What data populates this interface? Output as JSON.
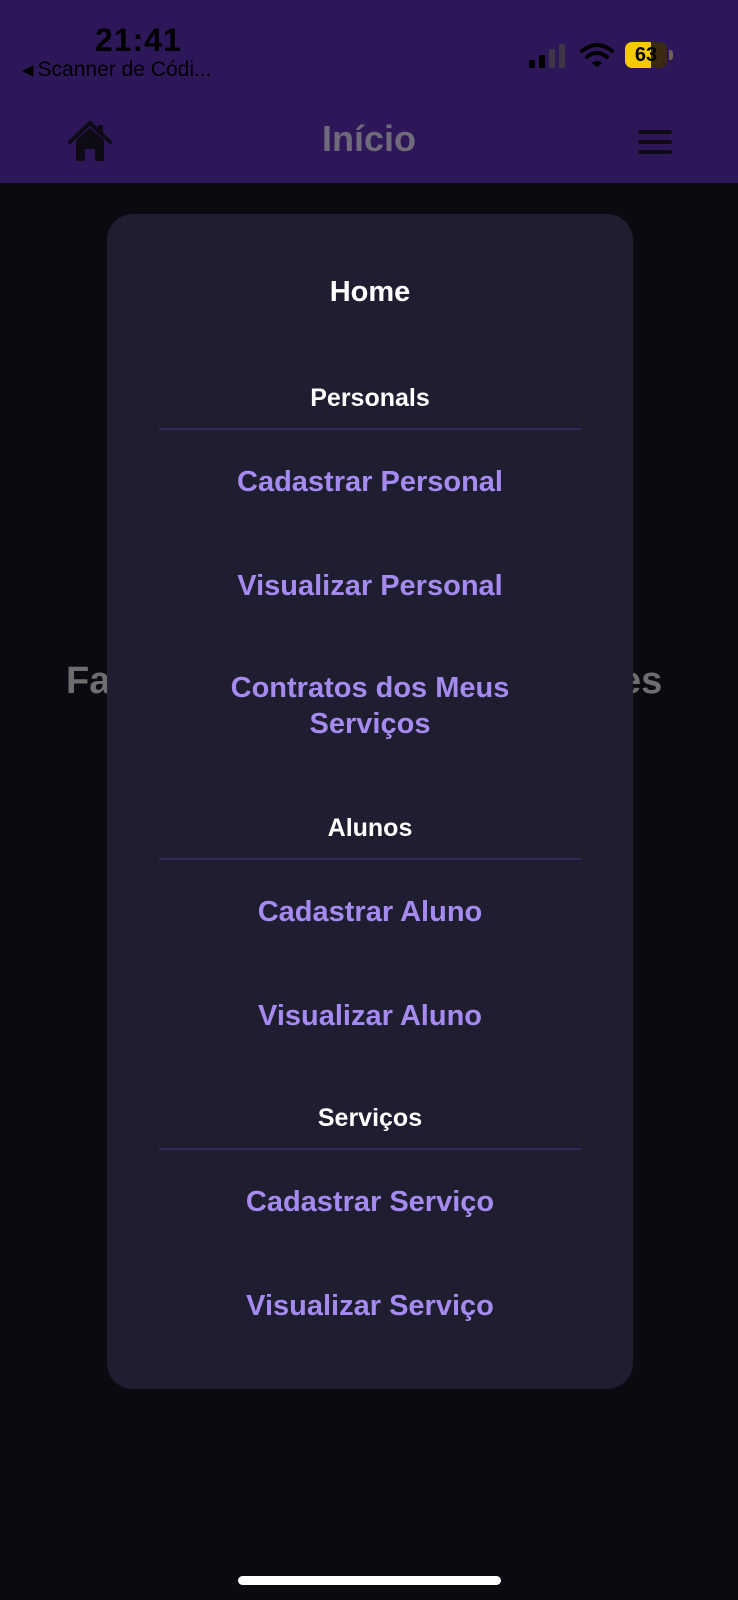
{
  "status_bar": {
    "time": "21:41",
    "back_app": "Scanner de Códi...",
    "battery_level": "63",
    "battery_percent": 63
  },
  "header": {
    "title": "Início",
    "home_icon": "home-icon",
    "menu_icon": "hamburger-menu-icon"
  },
  "background": {
    "text_left": "Fa",
    "text_right": "es"
  },
  "menu": {
    "home": "Home",
    "sections": [
      {
        "title": "Personals",
        "items": [
          "Cadastrar Personal",
          "Visualizar Personal",
          "Contratos dos Meus Serviços"
        ]
      },
      {
        "title": "Alunos",
        "items": [
          "Cadastrar Aluno",
          "Visualizar Aluno"
        ]
      },
      {
        "title": "Serviços",
        "items": [
          "Cadastrar Serviço",
          "Visualizar Serviço"
        ]
      }
    ]
  },
  "colors": {
    "header_bg": "#2d1758",
    "page_bg": "#0b0a10",
    "menu_bg": "#1f1d30",
    "menu_link": "#a58bf0",
    "battery": "#f7c900"
  }
}
